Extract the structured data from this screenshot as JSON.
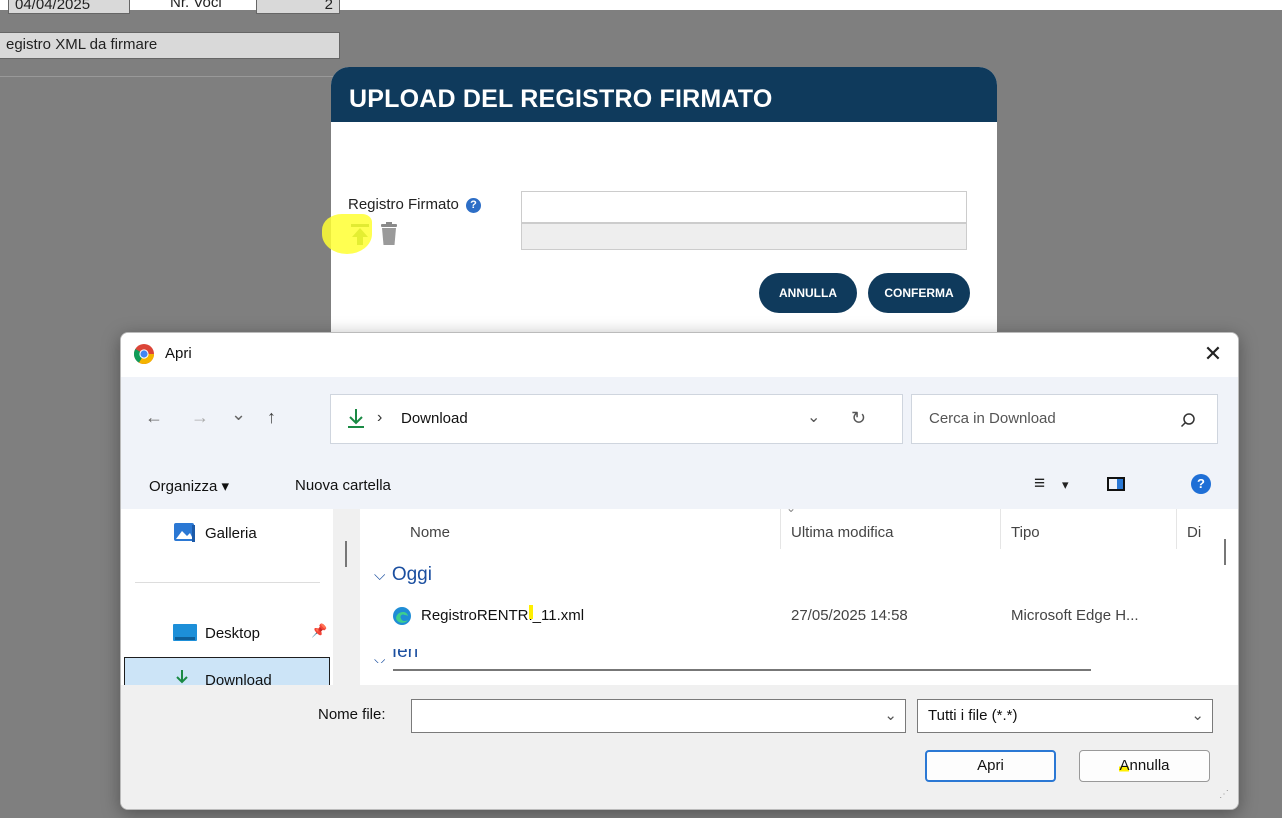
{
  "background": {
    "date_field": "04/04/2025",
    "year_label": "Nr. Voci",
    "year_value": "2",
    "registry_field": "egistro XML da firmare"
  },
  "modal": {
    "title": "UPLOAD DEL REGISTRO FIRMATO",
    "field_label": "Registro Firmato",
    "help_symbol": "?",
    "cancel_label": "ANNULLA",
    "confirm_label": "CONFERMA",
    "accent_color": "#0f3a5c"
  },
  "dialog": {
    "title": "Apri",
    "close_symbol": "✕",
    "nav": {
      "back": "←",
      "forward": "→",
      "recent": "⌄",
      "up": "↑"
    },
    "address": {
      "separator": "›",
      "location": "Download"
    },
    "search_placeholder": "Cerca in Download",
    "toolbar": {
      "organize": "Organizza ▾",
      "new_folder": "Nuova cartella",
      "view_menu": "▾",
      "help": "?"
    },
    "nav_pane": [
      {
        "label": "Galleria",
        "icon": "gallery-icon"
      },
      {
        "label": "Desktop",
        "icon": "desktop-icon"
      },
      {
        "label": "Download",
        "icon": "download-icon"
      }
    ],
    "columns": [
      "Nome",
      "Ultima modifica",
      "Tipo",
      "Di"
    ],
    "groups": [
      {
        "name": "Oggi",
        "files": [
          {
            "name": "RegistroRENTRI_11.xml",
            "modified": "27/05/2025 14:58",
            "type": "Microsoft Edge H..."
          }
        ]
      },
      {
        "name": "Ieri",
        "files": []
      }
    ],
    "filename_label": "Nome file:",
    "filename_value": "",
    "filter_value": "Tutti i file (*.*)",
    "open_label": "Apri",
    "cancel_label": "Annulla"
  }
}
